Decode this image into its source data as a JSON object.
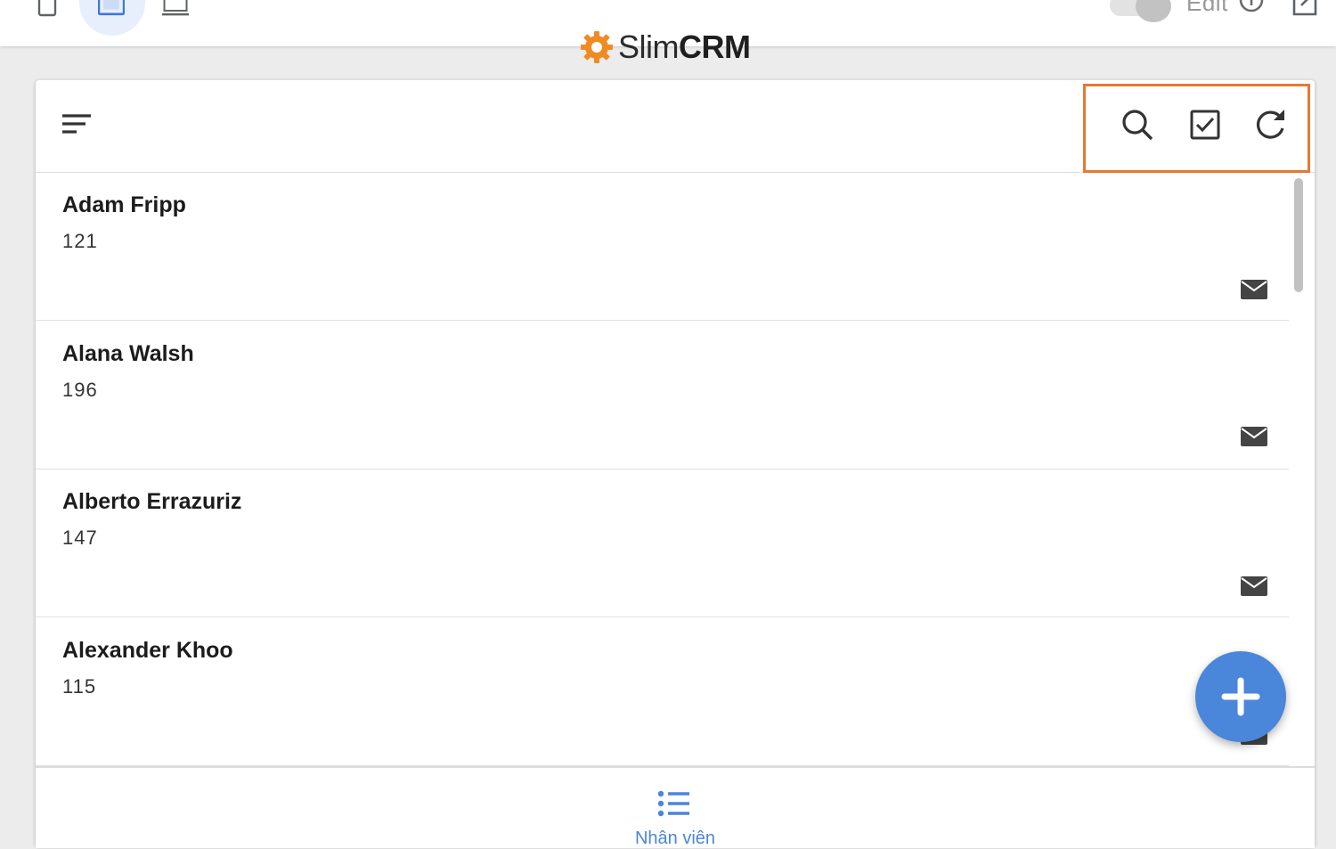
{
  "app": {
    "brand_prefix": "Slim",
    "brand_suffix": "CRM",
    "edit_label": "Edit"
  },
  "colors": {
    "accent": "#4a86d9",
    "highlight": "#e8782f",
    "brand_gear": "#f08a24"
  },
  "toolbar": {
    "icons": [
      "sort-icon",
      "search-icon",
      "checkbox-icon",
      "refresh-icon"
    ]
  },
  "contacts": [
    {
      "name": "Adam Fripp",
      "number": "121"
    },
    {
      "name": "Alana Walsh",
      "number": "196"
    },
    {
      "name": "Alberto Errazuriz",
      "number": "147"
    },
    {
      "name": "Alexander Khoo",
      "number": "115"
    }
  ],
  "bottom_nav": {
    "label": "Nhân viên"
  }
}
